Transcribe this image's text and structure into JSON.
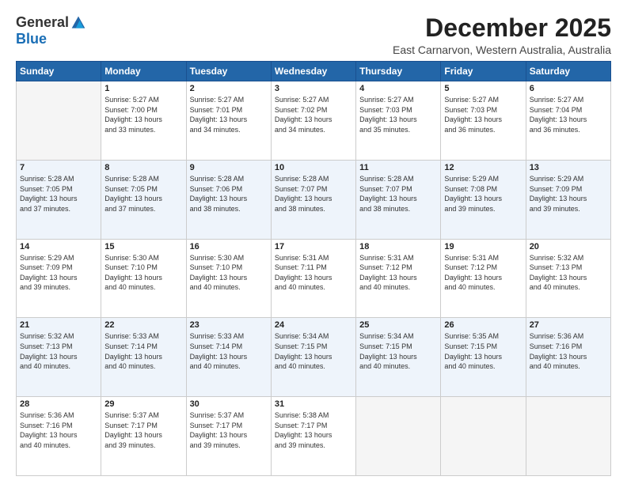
{
  "logo": {
    "general": "General",
    "blue": "Blue"
  },
  "title": "December 2025",
  "location": "East Carnarvon, Western Australia, Australia",
  "days_of_week": [
    "Sunday",
    "Monday",
    "Tuesday",
    "Wednesday",
    "Thursday",
    "Friday",
    "Saturday"
  ],
  "weeks": [
    [
      {
        "day": "",
        "info": ""
      },
      {
        "day": "1",
        "info": "Sunrise: 5:27 AM\nSunset: 7:00 PM\nDaylight: 13 hours\nand 33 minutes."
      },
      {
        "day": "2",
        "info": "Sunrise: 5:27 AM\nSunset: 7:01 PM\nDaylight: 13 hours\nand 34 minutes."
      },
      {
        "day": "3",
        "info": "Sunrise: 5:27 AM\nSunset: 7:02 PM\nDaylight: 13 hours\nand 34 minutes."
      },
      {
        "day": "4",
        "info": "Sunrise: 5:27 AM\nSunset: 7:03 PM\nDaylight: 13 hours\nand 35 minutes."
      },
      {
        "day": "5",
        "info": "Sunrise: 5:27 AM\nSunset: 7:03 PM\nDaylight: 13 hours\nand 36 minutes."
      },
      {
        "day": "6",
        "info": "Sunrise: 5:27 AM\nSunset: 7:04 PM\nDaylight: 13 hours\nand 36 minutes."
      }
    ],
    [
      {
        "day": "7",
        "info": "Sunrise: 5:28 AM\nSunset: 7:05 PM\nDaylight: 13 hours\nand 37 minutes."
      },
      {
        "day": "8",
        "info": "Sunrise: 5:28 AM\nSunset: 7:05 PM\nDaylight: 13 hours\nand 37 minutes."
      },
      {
        "day": "9",
        "info": "Sunrise: 5:28 AM\nSunset: 7:06 PM\nDaylight: 13 hours\nand 38 minutes."
      },
      {
        "day": "10",
        "info": "Sunrise: 5:28 AM\nSunset: 7:07 PM\nDaylight: 13 hours\nand 38 minutes."
      },
      {
        "day": "11",
        "info": "Sunrise: 5:28 AM\nSunset: 7:07 PM\nDaylight: 13 hours\nand 38 minutes."
      },
      {
        "day": "12",
        "info": "Sunrise: 5:29 AM\nSunset: 7:08 PM\nDaylight: 13 hours\nand 39 minutes."
      },
      {
        "day": "13",
        "info": "Sunrise: 5:29 AM\nSunset: 7:09 PM\nDaylight: 13 hours\nand 39 minutes."
      }
    ],
    [
      {
        "day": "14",
        "info": "Sunrise: 5:29 AM\nSunset: 7:09 PM\nDaylight: 13 hours\nand 39 minutes."
      },
      {
        "day": "15",
        "info": "Sunrise: 5:30 AM\nSunset: 7:10 PM\nDaylight: 13 hours\nand 40 minutes."
      },
      {
        "day": "16",
        "info": "Sunrise: 5:30 AM\nSunset: 7:10 PM\nDaylight: 13 hours\nand 40 minutes."
      },
      {
        "day": "17",
        "info": "Sunrise: 5:31 AM\nSunset: 7:11 PM\nDaylight: 13 hours\nand 40 minutes."
      },
      {
        "day": "18",
        "info": "Sunrise: 5:31 AM\nSunset: 7:12 PM\nDaylight: 13 hours\nand 40 minutes."
      },
      {
        "day": "19",
        "info": "Sunrise: 5:31 AM\nSunset: 7:12 PM\nDaylight: 13 hours\nand 40 minutes."
      },
      {
        "day": "20",
        "info": "Sunrise: 5:32 AM\nSunset: 7:13 PM\nDaylight: 13 hours\nand 40 minutes."
      }
    ],
    [
      {
        "day": "21",
        "info": "Sunrise: 5:32 AM\nSunset: 7:13 PM\nDaylight: 13 hours\nand 40 minutes."
      },
      {
        "day": "22",
        "info": "Sunrise: 5:33 AM\nSunset: 7:14 PM\nDaylight: 13 hours\nand 40 minutes."
      },
      {
        "day": "23",
        "info": "Sunrise: 5:33 AM\nSunset: 7:14 PM\nDaylight: 13 hours\nand 40 minutes."
      },
      {
        "day": "24",
        "info": "Sunrise: 5:34 AM\nSunset: 7:15 PM\nDaylight: 13 hours\nand 40 minutes."
      },
      {
        "day": "25",
        "info": "Sunrise: 5:34 AM\nSunset: 7:15 PM\nDaylight: 13 hours\nand 40 minutes."
      },
      {
        "day": "26",
        "info": "Sunrise: 5:35 AM\nSunset: 7:15 PM\nDaylight: 13 hours\nand 40 minutes."
      },
      {
        "day": "27",
        "info": "Sunrise: 5:36 AM\nSunset: 7:16 PM\nDaylight: 13 hours\nand 40 minutes."
      }
    ],
    [
      {
        "day": "28",
        "info": "Sunrise: 5:36 AM\nSunset: 7:16 PM\nDaylight: 13 hours\nand 40 minutes."
      },
      {
        "day": "29",
        "info": "Sunrise: 5:37 AM\nSunset: 7:17 PM\nDaylight: 13 hours\nand 39 minutes."
      },
      {
        "day": "30",
        "info": "Sunrise: 5:37 AM\nSunset: 7:17 PM\nDaylight: 13 hours\nand 39 minutes."
      },
      {
        "day": "31",
        "info": "Sunrise: 5:38 AM\nSunset: 7:17 PM\nDaylight: 13 hours\nand 39 minutes."
      },
      {
        "day": "",
        "info": ""
      },
      {
        "day": "",
        "info": ""
      },
      {
        "day": "",
        "info": ""
      }
    ]
  ]
}
